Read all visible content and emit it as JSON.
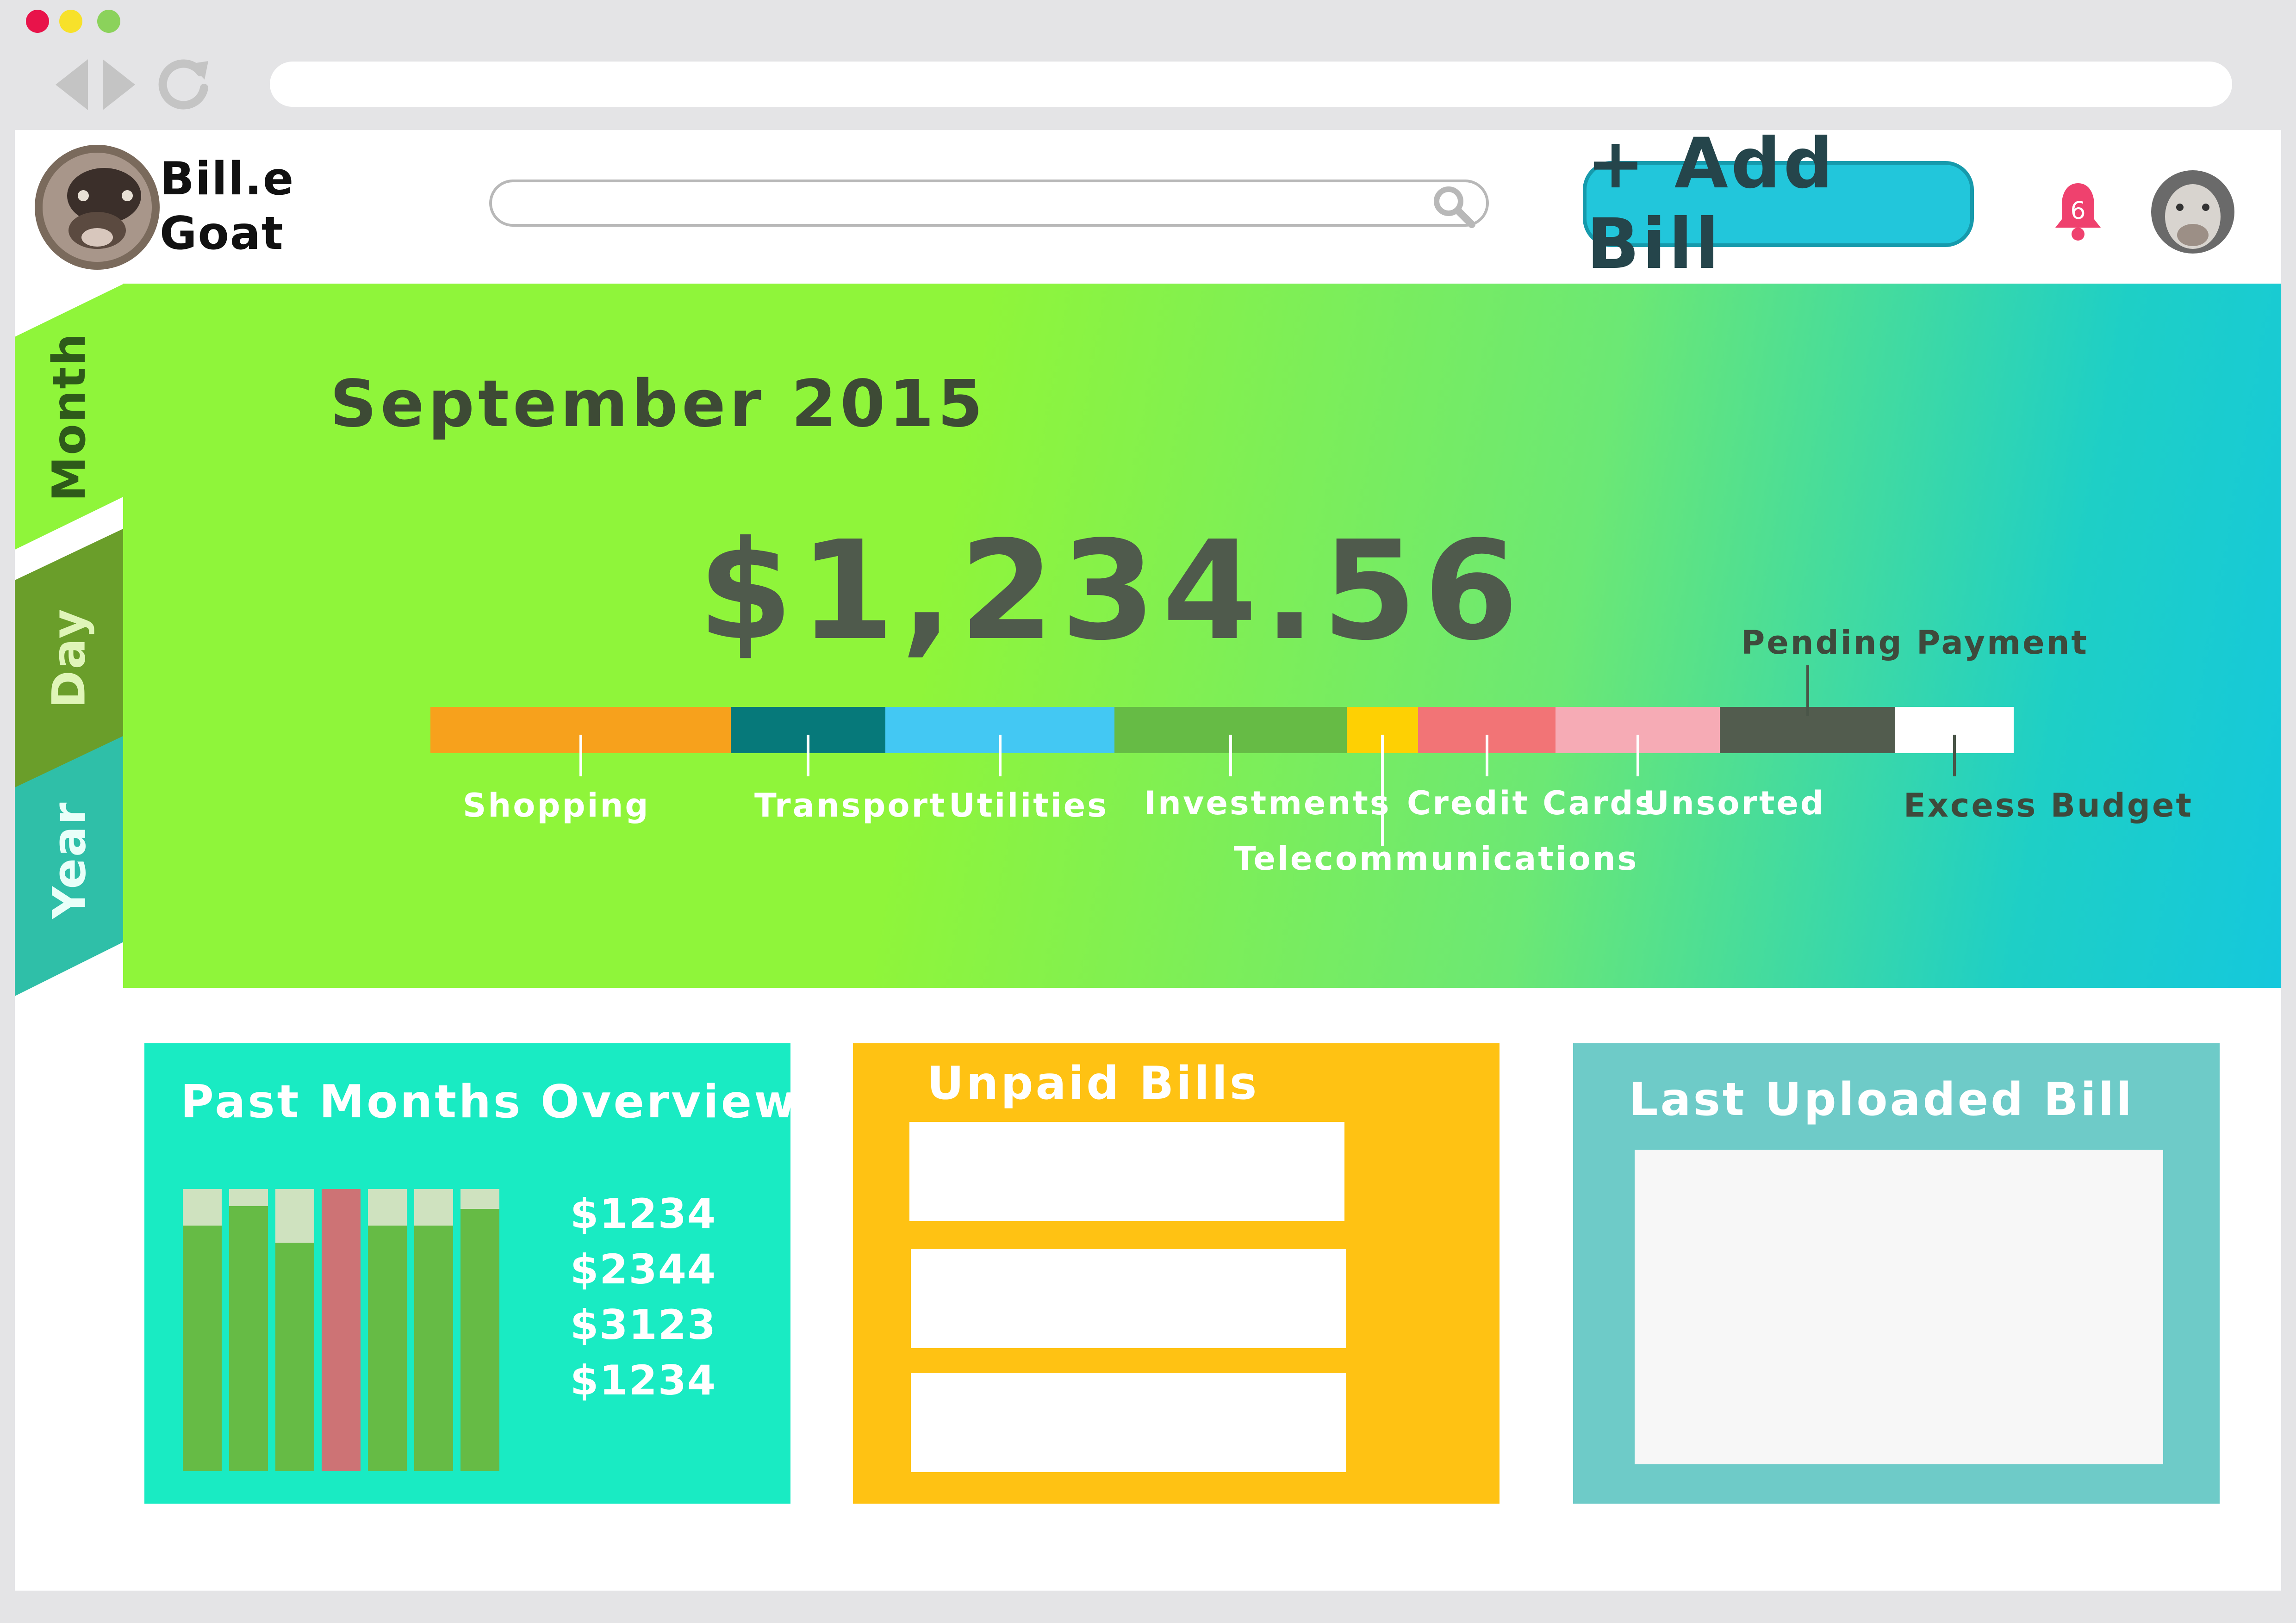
{
  "browser": {
    "dot_colors": [
      "#e8134a",
      "#f7e12a",
      "#8bd25b"
    ],
    "nav_icons": [
      "back-arrow-icon",
      "forward-arrow-icon",
      "reload-icon"
    ]
  },
  "header": {
    "brand_line1": "Bill.e",
    "brand_line2": "Goat",
    "logo_icon": "goat-logo-icon",
    "search_icon": "magnifier-icon",
    "add_bill_label": "+ Add Bill",
    "notification_count": "6",
    "notification_icon": "bell-icon",
    "avatar_icon": "goat-avatar-icon"
  },
  "tabs": [
    {
      "label": "Month",
      "active": true,
      "color": "#8ff53a"
    },
    {
      "label": "Day",
      "active": false,
      "color": "#6a9e2a"
    },
    {
      "label": "Year",
      "active": false,
      "color": "#2fbfa8"
    }
  ],
  "summary": {
    "period": "September 2015",
    "total": "$1,234.56"
  },
  "categories": [
    {
      "label": "Shopping",
      "color": "#f7a11c",
      "share": 0.19
    },
    {
      "label": "Transport",
      "color": "#06797a",
      "share": 0.098
    },
    {
      "label": "Utilities",
      "color": "#43c8f3",
      "share": 0.145
    },
    {
      "label": "Investments",
      "color": "#66bb45",
      "share": 0.147
    },
    {
      "label": "Telecommunications",
      "color": "#fed003",
      "share": 0.045
    },
    {
      "label": "Credit Cards",
      "color": "#f27476",
      "share": 0.087
    },
    {
      "label": "Unsorted",
      "color": "#f6abb5",
      "share": 0.104
    },
    {
      "label": "Pending Payment",
      "color": "#525c4e",
      "share": 0.111
    },
    {
      "label": "Excess Budget",
      "color": "#ffffff",
      "share": 0.075
    }
  ],
  "panels": {
    "past_months": {
      "title": "Past Months Overview",
      "bg": "#19ebc3",
      "amounts": [
        "$1234",
        "$2344",
        "$3123",
        "$1234"
      ],
      "bars": [
        {
          "fill": 0.87,
          "color": "#66bb45"
        },
        {
          "fill": 0.94,
          "color": "#66bb45"
        },
        {
          "fill": 0.81,
          "color": "#66bb45"
        },
        {
          "fill": 1.0,
          "color": "#cd7375"
        },
        {
          "fill": 0.87,
          "color": "#66bb45"
        },
        {
          "fill": 0.87,
          "color": "#66bb45"
        },
        {
          "fill": 0.93,
          "color": "#66bb45"
        }
      ]
    },
    "unpaid": {
      "title": "Unpaid Bills",
      "bg": "#ffc213"
    },
    "last_uploaded": {
      "title": "Last Uploaded Bill",
      "bg": "#6ecbc8"
    }
  }
}
